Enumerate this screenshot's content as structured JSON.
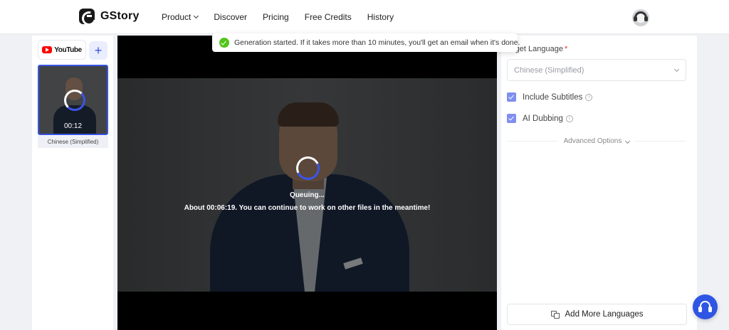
{
  "header": {
    "brand": "GStory",
    "nav": [
      {
        "label": "Product",
        "has_dropdown": true
      },
      {
        "label": "Discover"
      },
      {
        "label": "Pricing"
      },
      {
        "label": "Free Credits"
      },
      {
        "label": "History"
      }
    ]
  },
  "sidebar": {
    "source_tab": "YouTube",
    "add_label": "+",
    "thumbnail": {
      "duration": "00:12",
      "language": "Chinese (Simplified)"
    }
  },
  "video": {
    "status": "Queuing...",
    "message": "About 00:06:19. You can continue to work on other files in the meantime!"
  },
  "toast": {
    "message": "Generation started. If it takes more than 10 minutes, you'll get an email when it's done."
  },
  "settings": {
    "target_language_label": "rget Language",
    "required_mark": "*",
    "target_language_value": "Chinese (Simplified)",
    "include_subtitles": {
      "label": "Include Subtitles",
      "checked": true
    },
    "ai_dubbing": {
      "label": "AI Dubbing",
      "checked": true
    },
    "advanced_options": "Advanced Options",
    "add_more_languages": "Add More Languages"
  },
  "colors": {
    "accent": "#3b55e8",
    "success": "#52c41a",
    "checkbox": "#7e8ff0"
  }
}
